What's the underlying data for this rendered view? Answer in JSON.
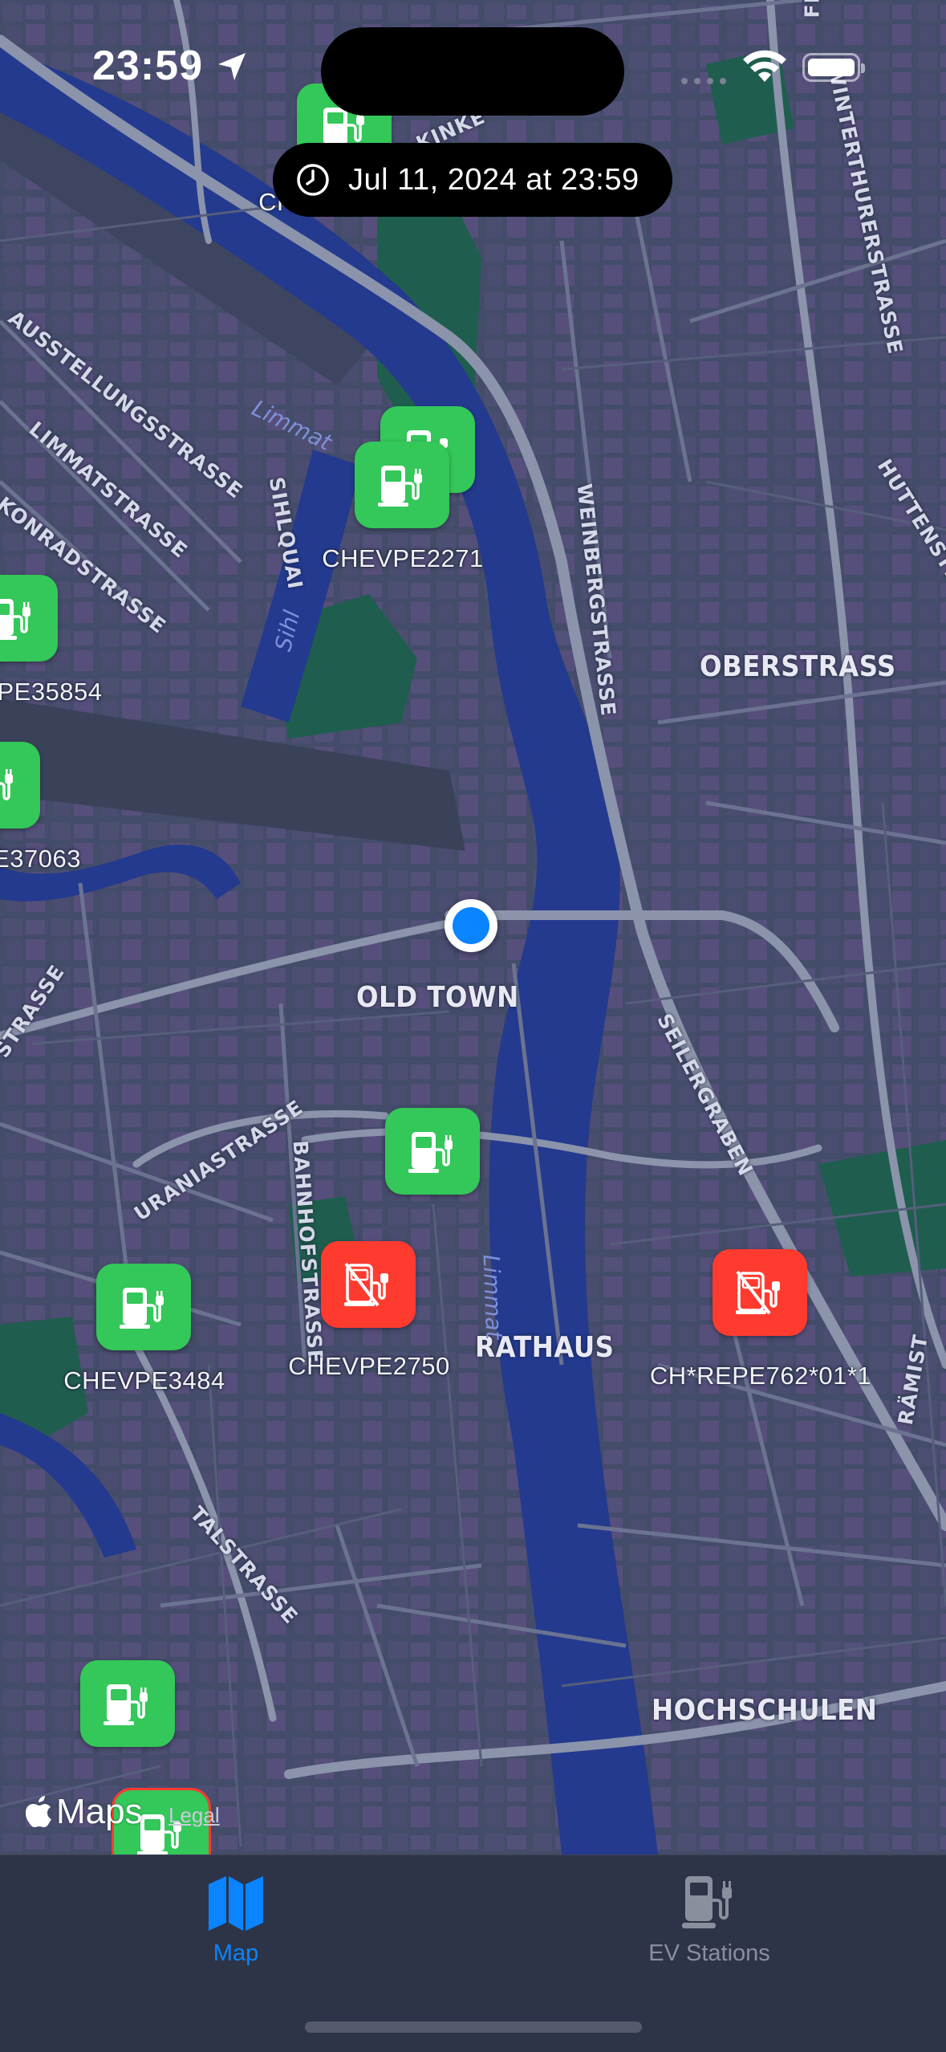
{
  "status_bar": {
    "time": "23:59",
    "icons": [
      "location-arrow-icon",
      "wifi-icon",
      "battery-icon"
    ]
  },
  "date_pill": {
    "icon": "clock-icon",
    "text": "Jul 11, 2024 at 23:59"
  },
  "map": {
    "area_labels": [
      "OBERSTRASS",
      "OLD TOWN",
      "RATHAUS",
      "HOCHSCHULEN"
    ],
    "street_labels": [
      "WEINBERGSTRASSE",
      "SEILERGRABEN",
      "URANIASTRASSE",
      "BAHNHOFSTRASSE",
      "TALSTRASSE",
      "AUSSTELLUNGSSTRASSE",
      "LIMMATSTRASSE",
      "KONRADSTRASSE",
      "SIHLQUAI",
      "WINTERTHURERSTRASSE",
      "HUTTENSTR",
      "RÄMIST",
      "STRASSE",
      "KINKE",
      "FRO"
    ],
    "river_labels": [
      "Limmat",
      "Sihl",
      "Limmat"
    ],
    "stations": [
      {
        "id": "CH",
        "status": "available",
        "icon": "ev-charger-icon"
      },
      {
        "id": "CHEVPE2271",
        "status": "available",
        "icon": "ev-charger-icon"
      },
      {
        "id": "PE35854",
        "status": "available",
        "icon": "ev-charger-icon"
      },
      {
        "id": "E37063",
        "status": "available",
        "icon": "ev-charger-icon"
      },
      {
        "id": "",
        "status": "available",
        "icon": "ev-charger-icon"
      },
      {
        "id": "CHEVPE3484",
        "status": "available",
        "icon": "ev-charger-icon"
      },
      {
        "id": "CHEVPE2750",
        "status": "unavailable",
        "icon": "ev-charger-slash-icon"
      },
      {
        "id": "CH*REPE762*01*1",
        "status": "unavailable",
        "icon": "ev-charger-slash-icon"
      },
      {
        "id": "",
        "status": "available",
        "icon": "ev-charger-icon"
      },
      {
        "id": "",
        "status": "available",
        "icon": "ev-charger-icon"
      }
    ],
    "attribution": {
      "brand": "Maps",
      "legal": "Legal"
    }
  },
  "tab_bar": {
    "tabs": [
      {
        "label": "Map",
        "icon": "map-icon",
        "active": true
      },
      {
        "label": "EV Stations",
        "icon": "ev-charger-icon",
        "active": false
      }
    ]
  },
  "colors": {
    "available": "#34c759",
    "unavailable": "#ff3b30",
    "accent": "#0a84ff",
    "water": "#233a8f",
    "park": "#1f5e4e"
  }
}
